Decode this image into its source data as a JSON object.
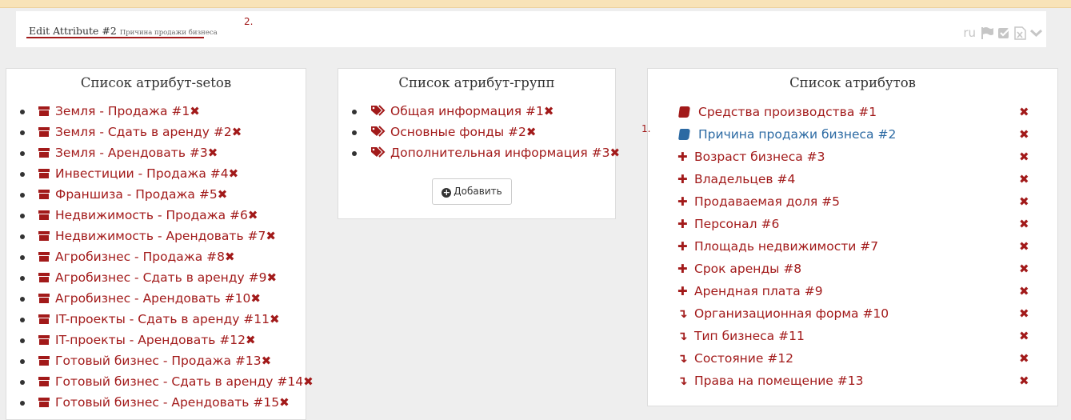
{
  "header": {
    "title": "Edit Attribute #2",
    "subtitle": "Причина продажи бизнеса",
    "annotation": "2.",
    "lang": "ru",
    "icons": [
      "flag-icon",
      "check-square-icon",
      "file-excel-icon",
      "chevron-down-icon"
    ]
  },
  "attribute_sets": {
    "title": "Список атрибут-setов",
    "items": [
      {
        "label": "Земля - Продажа #1"
      },
      {
        "label": "Земля - Сдать в аренду #2"
      },
      {
        "label": "Земля - Арендовать #3"
      },
      {
        "label": "Инвестиции - Продажа #4"
      },
      {
        "label": "Франшиза - Продажа #5"
      },
      {
        "label": "Недвижимость - Продажа #6"
      },
      {
        "label": "Недвижимость - Арендовать #7"
      },
      {
        "label": "Агробизнес - Продажа #8"
      },
      {
        "label": "Агробизнес - Сдать в аренду #9"
      },
      {
        "label": "Агробизнес - Арендовать #10"
      },
      {
        "label": "IT-проекты - Сдать в аренду #11"
      },
      {
        "label": "IT-проекты - Арендовать #12"
      },
      {
        "label": "Готовый бизнес - Продажа #13"
      },
      {
        "label": "Готовый бизнес - Сдать в аренду #14"
      },
      {
        "label": "Готовый бизнес - Арендовать #15"
      }
    ]
  },
  "attribute_groups": {
    "title": "Список атрибут-групп",
    "items": [
      {
        "label": "Общая информация #1"
      },
      {
        "label": "Основные фонды #2"
      },
      {
        "label": "Дополнительная информация #3"
      }
    ],
    "add_button": "Добавить"
  },
  "attributes": {
    "title": "Список атрибутов",
    "annotation": "1.",
    "items": [
      {
        "label": "Средства производства #1",
        "icon": "book-icon"
      },
      {
        "label": "Причина продажи бизнеса #2",
        "icon": "book-icon",
        "active": true
      },
      {
        "label": "Возраст бизнеса #3",
        "icon": "plus-icon"
      },
      {
        "label": "Владельцев #4",
        "icon": "plus-icon"
      },
      {
        "label": "Продаваемая доля #5",
        "icon": "plus-icon"
      },
      {
        "label": "Персонал #6",
        "icon": "plus-icon"
      },
      {
        "label": "Площадь недвижимости #7",
        "icon": "plus-icon"
      },
      {
        "label": "Срок аренды #8",
        "icon": "plus-icon"
      },
      {
        "label": "Арендная плата #9",
        "icon": "plus-icon"
      },
      {
        "label": "Организационная форма #10",
        "icon": "level-down-icon"
      },
      {
        "label": "Тип бизнеса #11",
        "icon": "level-down-icon"
      },
      {
        "label": "Состояние #12",
        "icon": "level-down-icon"
      },
      {
        "label": "Права на помещение #13",
        "icon": "level-down-icon"
      }
    ]
  },
  "colors": {
    "accent": "#a21a1a",
    "active": "#2c6aa3",
    "top_strip": "#f8e3b8"
  }
}
